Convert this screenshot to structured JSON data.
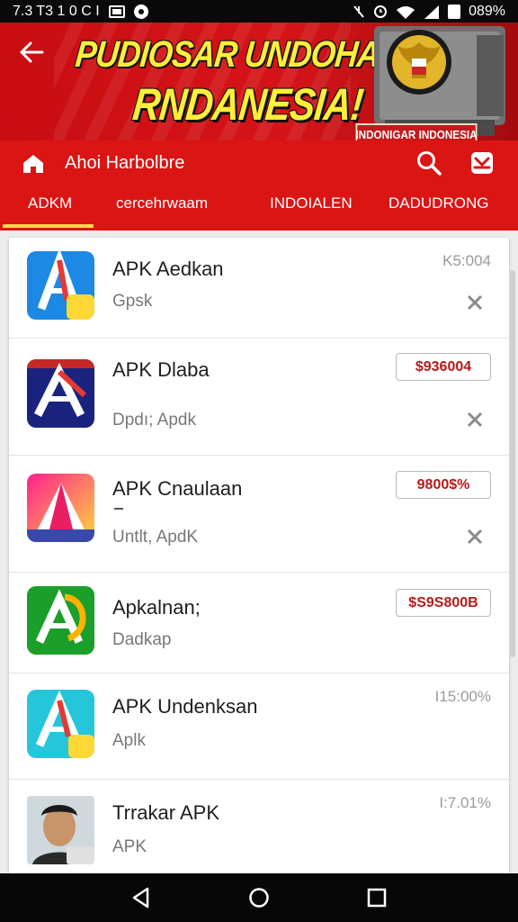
{
  "status_bar": {
    "time": "7.3 T3 1 0 C I",
    "battery": "089%"
  },
  "banner": {
    "headline_line1": "PUDIOSAR UNDOHAN",
    "headline_line2": "RNDANESIA!",
    "sign_text": "INDONIGAR INDONESIA"
  },
  "appbar": {
    "title": "Ahoi Harbolbre"
  },
  "tabs": [
    {
      "label": "ADKM",
      "active": true
    },
    {
      "label": "cercehrwaam",
      "active": false
    },
    {
      "label": "INDOIALEN",
      "active": false
    },
    {
      "label": "DADUDRONG",
      "active": false
    }
  ],
  "apps": [
    {
      "name": "APK Aedkan",
      "subtitle": "Gpsk",
      "meta": "K5:004",
      "badge": "",
      "has_close": true
    },
    {
      "name": "APK Dlaba",
      "subtitle": "Dpdı; Apdk",
      "meta": "",
      "badge": "$936004",
      "has_close": true
    },
    {
      "name": "APK Cnaulaan",
      "subtitle": "Untlt, ApdK",
      "meta": "",
      "badge": "9800$%",
      "has_close": true
    },
    {
      "name": "Apkalnan;",
      "subtitle": "Dadkap",
      "meta": "",
      "badge": "$S9S800B",
      "has_close": false
    },
    {
      "name": "APK Undenksan",
      "subtitle": "Aplk",
      "meta": "I15:00%",
      "badge": "",
      "has_close": false
    },
    {
      "name": "Trrakar APK",
      "subtitle": "APK",
      "meta": "I:7.01%",
      "badge": "",
      "has_close": false
    }
  ],
  "colors": {
    "brand_red": "#db1414",
    "banner_yellow": "#ffef3a",
    "tab_indicator": "#ffd54a",
    "badge_text": "#b31b1b"
  },
  "icons": {
    "back": "back-arrow-icon",
    "home": "home-icon",
    "search": "search-icon",
    "inbox": "inbox-icon",
    "close": "close-icon",
    "nav_back": "nav-back-icon",
    "nav_home": "nav-home-icon",
    "nav_recents": "nav-recents-icon"
  }
}
